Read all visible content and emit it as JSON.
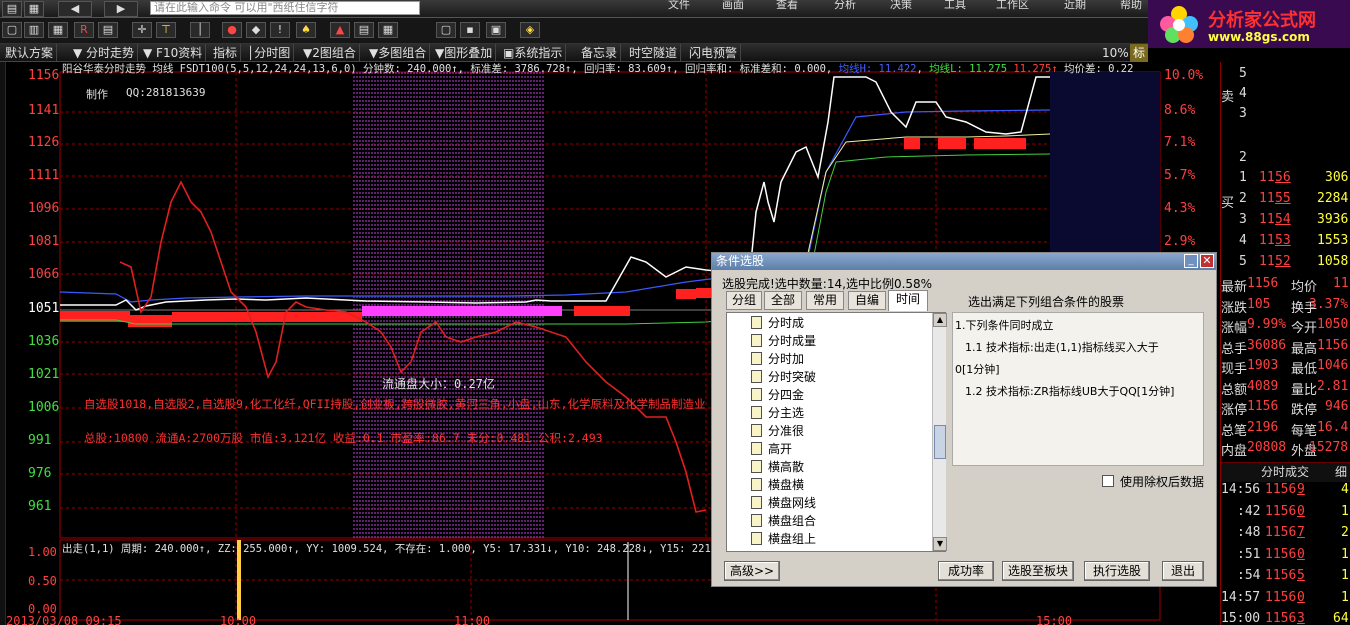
{
  "colors": {
    "up": "#ff3030",
    "down": "#30e030",
    "white": "#ffffff",
    "magenta": "#ff40ff",
    "yellow": "#ffff00"
  },
  "top": {
    "search_placeholder": "请在此输入命令 可以用\"西纸住信字符",
    "menus": [
      "文件",
      "画面",
      "查看",
      "分析",
      "决策",
      "工具",
      "工作区",
      "近期",
      "帮助"
    ]
  },
  "logo": {
    "title": "分析家公式网",
    "url": "www.88gs.com"
  },
  "toolbar": {
    "items": [
      "默认方案",
      "分时走势",
      "F10资料",
      "指标",
      "分时图",
      "2图组合",
      "多图组合",
      "图形叠加",
      "系统指示",
      "备忘录",
      "时空隧道",
      "闪电预警"
    ],
    "zoom": "10%",
    "biao": "标"
  },
  "chart": {
    "header": "阳谷华泰分时走势 均线 FSDT100(5,5,12,24,24,13,6,0) 分钟数: 240.000↑, 标准差: 3786.728↑, 回归率: 83.609↑, 回归率和: 标准差和: 0.000,",
    "header_lineh": "均线H: 11.422",
    "header_linel": "均线L: 11.275",
    "header_price": "11.275↑",
    "header_avg": "均价差: 0.22",
    "maker": "制作",
    "qq": "QQ:281813639",
    "y_labels": [
      "1156",
      "1141",
      "1126",
      "1111",
      "1096",
      "1081",
      "1066",
      "1051",
      "1036",
      "1021",
      "1006",
      "991",
      "976",
      "961"
    ],
    "pct_labels": [
      "10.0%",
      "8.6%",
      "7.1%",
      "5.7%",
      "4.3%",
      "2.9%"
    ],
    "float_cap": "流通盘大小：0.27亿",
    "sectors": "自选股1018,自选股2,自选股9,化工化纤,QFII持股,创业板,跨股微胶,黄河三角,小盘,山东,化学原料及化学制品制造业",
    "totals": "总股:10800 流通A:2700万股 市值:3.121亿 收益:0.1 市盈率:86.7 未分:0.481 公积:2.493",
    "sub_header": "出走(1,1) 周期: 240.000↑, ZZ: 255.000↑, YY: 1009.524, 不存在: 1.000, Y5: 17.331↓, Y10: 248.228↓, Y15: 221.043",
    "sub_y": [
      "1.00",
      "0.50",
      "0.00"
    ],
    "x_labels": [
      "2013/03/08 09:15",
      "10:00",
      "11:00",
      "15:00"
    ]
  },
  "right": {
    "sell": [
      [
        "5",
        "",
        ""
      ],
      [
        "4",
        "",
        ""
      ],
      [
        "3",
        "",
        ""
      ],
      [
        "2",
        "",
        ""
      ]
    ],
    "buy": [
      [
        "1",
        "11",
        "56",
        "306"
      ],
      [
        "2",
        "11",
        "55",
        "2284"
      ],
      [
        "3",
        "11",
        "54",
        "3936"
      ],
      [
        "4",
        "11",
        "53",
        "1553"
      ],
      [
        "5",
        "11",
        "52",
        "1058"
      ]
    ],
    "stats": [
      [
        "最新",
        "1156",
        "均价",
        "11"
      ],
      [
        "涨跌",
        "105",
        "换手",
        "3.37%"
      ],
      [
        "涨幅",
        "9.99%",
        "今开",
        "1050"
      ],
      [
        "总手",
        "36086",
        "最高",
        "1156"
      ],
      [
        "现手",
        "1903",
        "最低",
        "1046"
      ],
      [
        "总额",
        "4089",
        "量比",
        "2.81"
      ],
      [
        "涨停",
        "1156",
        "跌停",
        "946"
      ],
      [
        "总笔",
        "2196",
        "每笔",
        "16.4"
      ],
      [
        "内盘",
        "20808",
        "外盘",
        "15278"
      ]
    ],
    "trades_header": "分时成交",
    "trades_header2": "细",
    "trades": [
      [
        "14:56",
        "1156",
        "9",
        "4"
      ],
      [
        ":42",
        "1156",
        "0",
        "1"
      ],
      [
        ":48",
        "1156",
        "7",
        "2"
      ],
      [
        ":51",
        "1156",
        "0",
        "1"
      ],
      [
        ":54",
        "1156",
        "5",
        "1"
      ],
      [
        "14:57",
        "1156",
        "0",
        "1"
      ],
      [
        "15:00",
        "1156",
        "3",
        "64"
      ]
    ],
    "side_labels": [
      "卖",
      "买"
    ]
  },
  "dialog": {
    "title": "条件选股",
    "status": "选股完成!选中数量:14,选中比例0.58%",
    "tabs": [
      "分组",
      "全部",
      "常用",
      "自编",
      "时间"
    ],
    "tree": [
      "分时成",
      "分时成量",
      "分时加",
      "分时突破",
      "分四金",
      "分主选",
      "分准很",
      "高开",
      "横高散",
      "横盘横",
      "横盘网线",
      "横盘组合",
      "横盘组上"
    ],
    "cond_title": "选出满足下列组合条件的股票",
    "cond_lines": [
      "1.下列条件同时成立",
      "1.1 技术指标:出走(1,1)指标线买入大于",
      "0[1分钟]",
      "1.2 技术指标:ZR指标线UB大于QQ[1分钟]"
    ],
    "checkbox_label": "使用除权后数据",
    "buttons": [
      "高级>>",
      "成功率",
      "选股至板块",
      "执行选股",
      "退出"
    ]
  }
}
